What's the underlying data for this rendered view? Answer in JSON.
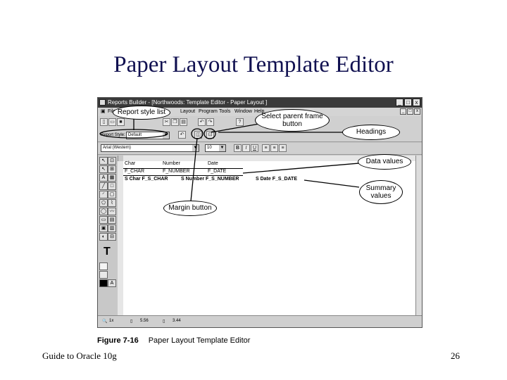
{
  "slide": {
    "title": "Paper Layout Template Editor",
    "footer_left": "Guide to Oracle 10g",
    "page_number": "26",
    "figure_label": "Figure 7-16",
    "figure_caption": "Paper Layout Template Editor"
  },
  "window": {
    "title": "Reports Builder - [Northwoods: Template Editor - Paper Layout ]",
    "controls": [
      "_",
      "□",
      "x"
    ]
  },
  "menu": {
    "items": [
      "File",
      "Layout",
      "Program",
      "Tools",
      "Window",
      "Help"
    ]
  },
  "toolbar": {
    "report_style_label": "Report Style:",
    "report_style_value": "Default",
    "font_value": "Arial (Western)",
    "font_size": "10",
    "bold": "B",
    "italic": "I",
    "underline": "U"
  },
  "canvas_rows": {
    "headings": [
      "Char",
      "Number",
      "Date"
    ],
    "data_values": [
      "F_CHAR",
      "F_NUMBER",
      "F_DATE"
    ],
    "summary_values": [
      "S Char F_S_CHAR",
      "S Number F_S_NUMBER",
      "S Date F_S_DATE"
    ]
  },
  "status": {
    "coord_x": "5.56",
    "coord_y": "3.44",
    "zoom": "1x"
  },
  "callouts": {
    "report_style_list": "Report style list",
    "select_parent_frame": "Select parent frame button",
    "headings": "Headings",
    "data_values": "Data values",
    "summary_values": "Summary values",
    "margin_button": "Margin button"
  }
}
